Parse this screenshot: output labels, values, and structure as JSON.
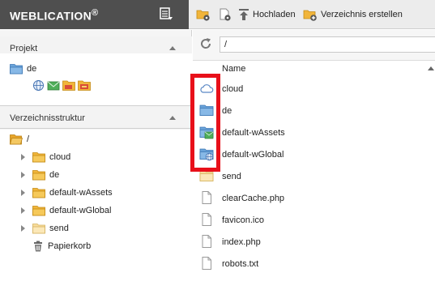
{
  "brand": {
    "name": "WEBLICATION",
    "mark": "®"
  },
  "toolbar": {
    "hochladen_label": "Hochladen",
    "verzeichnis_label": "Verzeichnis erstellen"
  },
  "projekt": {
    "heading": "Projekt",
    "item_label": "de",
    "sub_icons": [
      "globe-icon",
      "envelope-icon",
      "folder-assets-icon",
      "folder-global-icon"
    ]
  },
  "struktur": {
    "heading": "Verzeichnisstruktur",
    "root_label": "/",
    "items": [
      {
        "label": "cloud"
      },
      {
        "label": "de"
      },
      {
        "label": "default-wAssets"
      },
      {
        "label": "default-wGlobal"
      },
      {
        "label": "send"
      }
    ],
    "trash_label": "Papierkorb"
  },
  "pathbar": {
    "value": "/"
  },
  "list": {
    "column_name": "Name",
    "rows": [
      {
        "name": "cloud",
        "icon": "cloud-icon"
      },
      {
        "name": "de",
        "icon": "folder-blue-icon"
      },
      {
        "name": "default-wAssets",
        "icon": "folder-assets-icon"
      },
      {
        "name": "default-wGlobal",
        "icon": "folder-global-icon"
      },
      {
        "name": "send",
        "icon": "folder-light-icon"
      },
      {
        "name": "clearCache.php",
        "icon": "file-icon"
      },
      {
        "name": "favicon.ico",
        "icon": "file-icon"
      },
      {
        "name": "index.php",
        "icon": "file-icon"
      },
      {
        "name": "robots.txt",
        "icon": "file-icon"
      }
    ]
  },
  "colors": {
    "brand_bg": "#4f4f4f",
    "highlight": "#e8101a",
    "folder": "#f1b53b"
  }
}
